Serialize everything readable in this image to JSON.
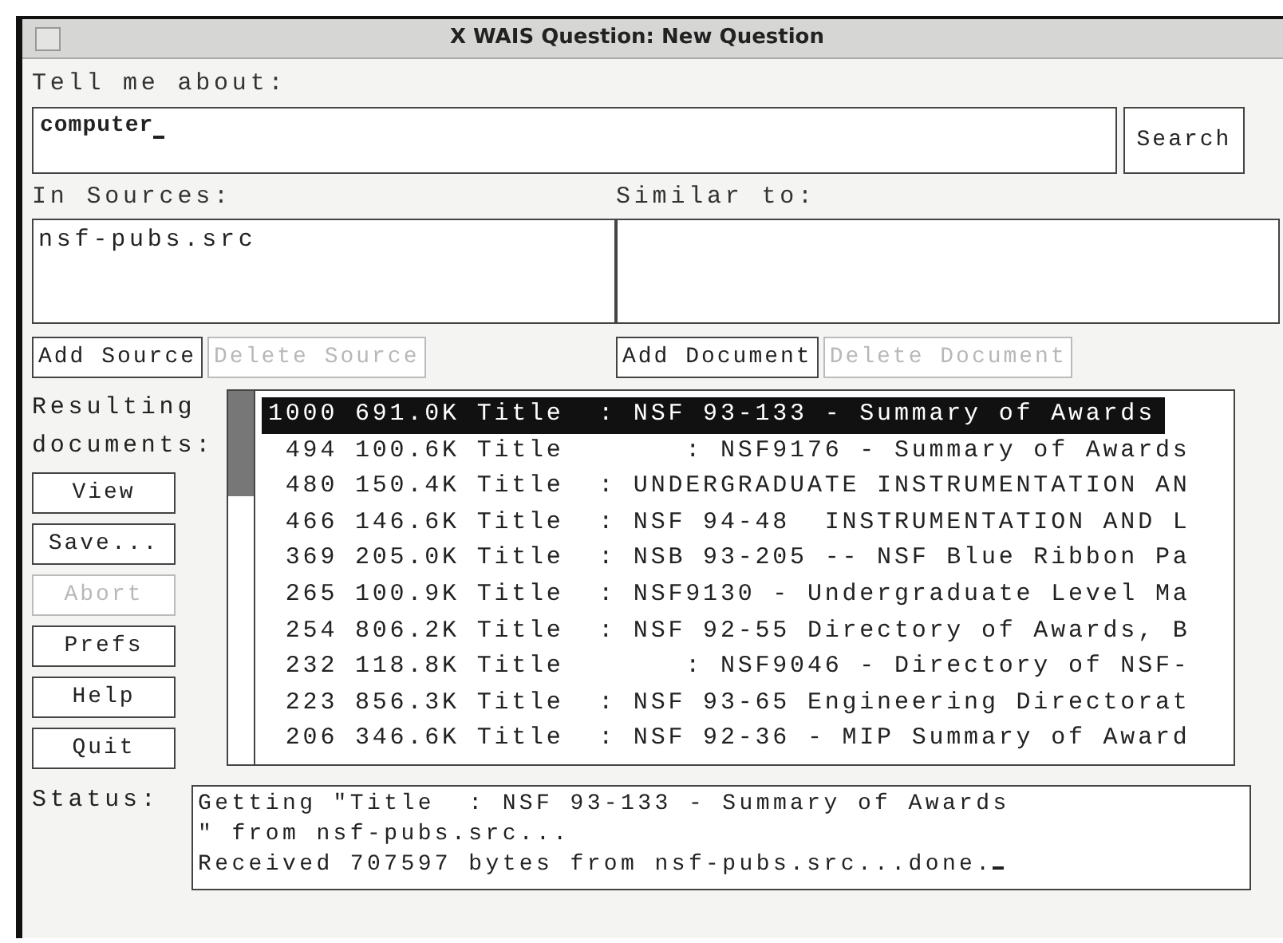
{
  "window": {
    "title": "X WAIS Question: New Question"
  },
  "question": {
    "label": "Tell me about:",
    "value": "computer"
  },
  "search_button": "Search",
  "sources": {
    "label": "In Sources:",
    "items": [
      "nsf-pubs.src"
    ]
  },
  "similar": {
    "label": "Similar to:"
  },
  "source_buttons": [
    {
      "label": "Add Source",
      "disabled": false
    },
    {
      "label": "Delete Source",
      "disabled": true
    }
  ],
  "document_buttons": [
    {
      "label": "Add Document",
      "disabled": false
    },
    {
      "label": "Delete Document",
      "disabled": true
    }
  ],
  "results_label": "Resulting documents:",
  "actions": [
    {
      "label": "View",
      "disabled": false
    },
    {
      "label": "Save...",
      "disabled": false
    },
    {
      "label": "Abort",
      "disabled": true
    },
    {
      "label": "Prefs",
      "disabled": false
    },
    {
      "label": "Help",
      "disabled": false
    },
    {
      "label": "Quit",
      "disabled": false
    }
  ],
  "results": [
    {
      "text": "1000 691.0K Title  : NSF 93-133 - Summary of Awards",
      "selected": true
    },
    {
      "text": " 494 100.6K Title       : NSF9176 - Summary of Awards",
      "selected": false
    },
    {
      "text": " 480 150.4K Title  : UNDERGRADUATE INSTRUMENTATION AN",
      "selected": false
    },
    {
      "text": " 466 146.6K Title  : NSF 94-48  INSTRUMENTATION AND L",
      "selected": false
    },
    {
      "text": " 369 205.0K Title  : NSB 93-205 -- NSF Blue Ribbon Pa",
      "selected": false
    },
    {
      "text": " 265 100.9K Title  : NSF9130 - Undergraduate Level Ma",
      "selected": false
    },
    {
      "text": " 254 806.2K Title  : NSF 92-55 Directory of Awards, B",
      "selected": false
    },
    {
      "text": " 232 118.8K Title       : NSF9046 - Directory of NSF-",
      "selected": false
    },
    {
      "text": " 223 856.3K Title  : NSF 93-65 Engineering Directorat",
      "selected": false
    },
    {
      "text": " 206 346.6K Title  : NSF 92-36 - MIP Summary of Award",
      "selected": false
    }
  ],
  "status": {
    "label": "Status:",
    "lines": [
      "Getting \"Title  : NSF 93-133 - Summary of Awards",
      "\" from nsf-pubs.src...",
      "Received 707597 bytes from nsf-pubs.src...done."
    ]
  }
}
